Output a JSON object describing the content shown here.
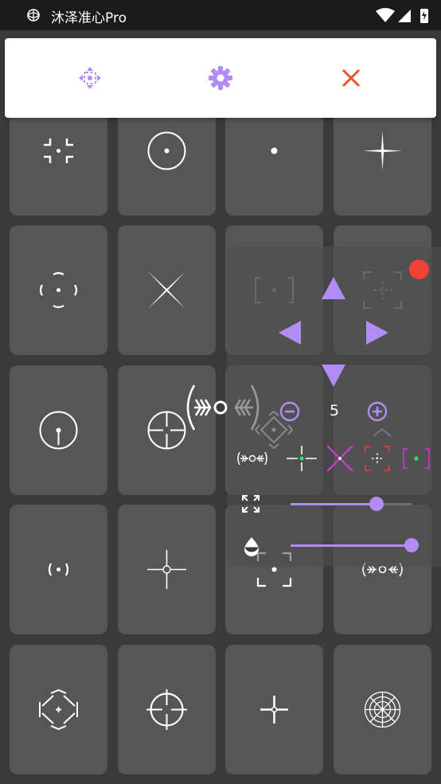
{
  "status_bar": {
    "app_title": "沐泽准心Pro"
  },
  "toolbar": {
    "move_icon": "move-arrows-icon",
    "settings_icon": "gear-icon",
    "close_icon": "close-icon",
    "accent_color": "#b28cf5",
    "close_color": "#f04e23"
  },
  "crosshair_grid": {
    "columns": 4,
    "rows": 5,
    "items": [
      "corner-brackets-crosshair-icon",
      "circle-dot-crosshair-icon",
      "dot-crosshair-icon",
      "star-cross-crosshair-icon",
      "parenthesis-dot-crosshair-icon",
      "x-cross-crosshair-icon",
      "square-bracket-crosshair-icon",
      "bracket-cross-crosshair-icon",
      "circle-tick-crosshair-icon",
      "circle-cross-crosshair-icon",
      "chevron-circle-crosshair-icon",
      "dotted-bracket-crosshair-icon",
      "small-paren-dot-crosshair-icon",
      "cross-circle-crosshair-icon",
      "corner-dot-crosshair-icon",
      "chevron-circle-small-crosshair-icon",
      "diamond-crosshair-icon",
      "scope-crosshair-icon",
      "plus-crosshair-icon",
      "target-rings-crosshair-icon"
    ]
  },
  "control_panel": {
    "record_indicator_color": "#f04336",
    "size_value": "5",
    "preview_styles": [
      "chevron-circle-style-icon",
      "green-dot-cross-style-icon",
      "magenta-x-style-icon",
      "red-bracket-style-icon",
      "magenta-bracket-style-icon"
    ],
    "scale_slider_value": 0.71,
    "opacity_slider_value": 1.0
  }
}
